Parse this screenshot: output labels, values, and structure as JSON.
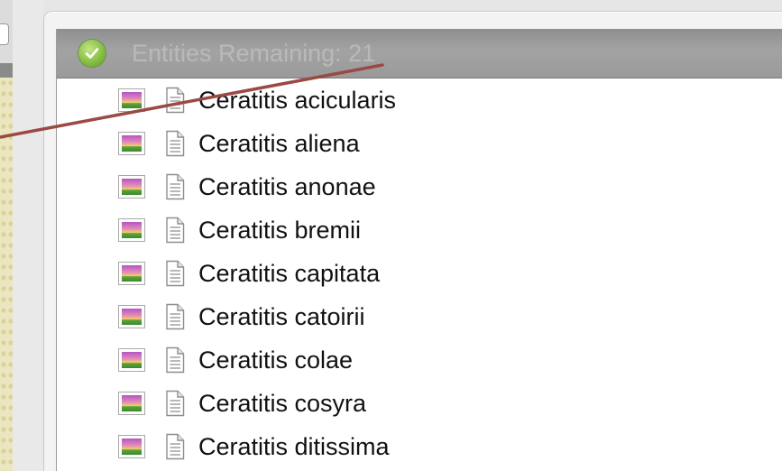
{
  "panel": {
    "title": "Entities Remaining: 21",
    "header_icon": "check-icon"
  },
  "entities": [
    {
      "label": "Ceratitis acicularis",
      "icons": [
        "image-icon",
        "document-icon"
      ]
    },
    {
      "label": "Ceratitis aliena",
      "icons": [
        "image-icon",
        "document-icon"
      ]
    },
    {
      "label": "Ceratitis anonae",
      "icons": [
        "image-icon",
        "document-icon"
      ]
    },
    {
      "label": "Ceratitis bremii",
      "icons": [
        "image-icon",
        "document-icon"
      ]
    },
    {
      "label": "Ceratitis capitata",
      "icons": [
        "image-icon",
        "document-icon"
      ]
    },
    {
      "label": "Ceratitis catoirii",
      "icons": [
        "image-icon",
        "document-icon"
      ]
    },
    {
      "label": "Ceratitis colae",
      "icons": [
        "image-icon",
        "document-icon"
      ]
    },
    {
      "label": "Ceratitis cosyra",
      "icons": [
        "image-icon",
        "document-icon"
      ]
    },
    {
      "label": "Ceratitis ditissima",
      "icons": [
        "image-icon",
        "document-icon"
      ]
    }
  ],
  "colors": {
    "connector": "#9a4a45",
    "header_bg": "#9a9a9a",
    "header_text": "#b9b9b9",
    "check_green": "#86c043"
  }
}
